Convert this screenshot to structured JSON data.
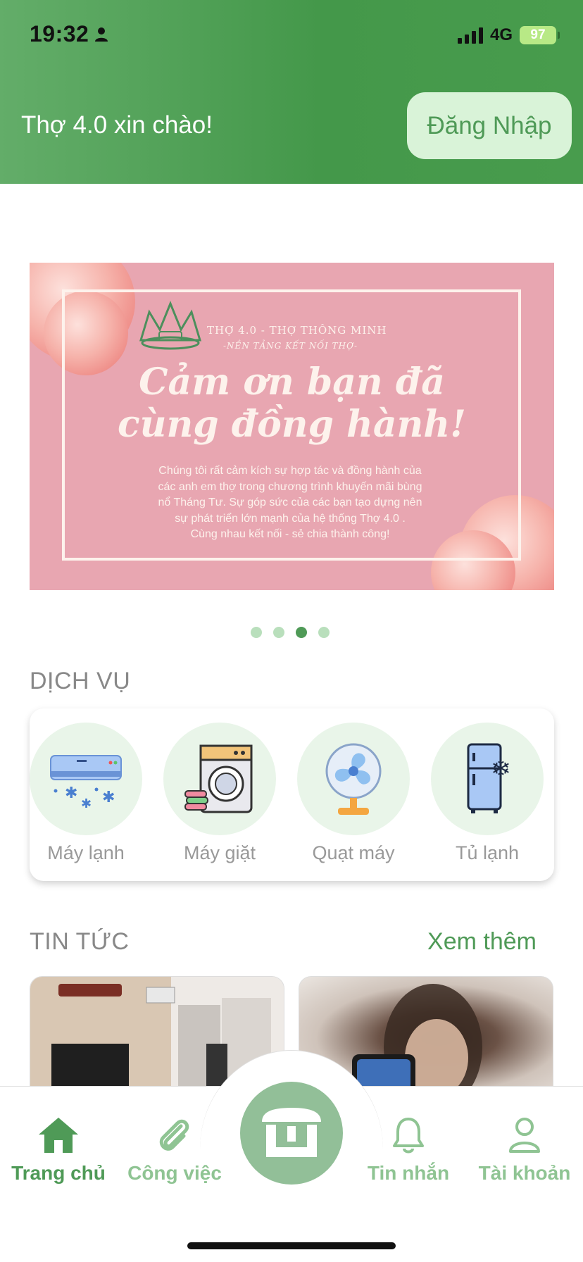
{
  "status": {
    "time": "19:32",
    "network": "4G",
    "battery": "97"
  },
  "header": {
    "greeting": "Thợ 4.0 xin chào!",
    "login_label": "Đăng Nhập"
  },
  "banner": {
    "brand": "THỢ 4.0 - THỢ THÔNG MINH",
    "brand_sub": "-NỀN TẢNG KẾT NỐI THỢ-",
    "title_line1": "Cảm ơn bạn đã",
    "title_line2": "cùng đồng hành!",
    "body": [
      "Chúng tôi rất cảm kích sự hợp tác và đồng hành của",
      "các anh em thợ trong chương trình khuyến mãi bùng",
      "nổ Tháng Tư. Sự góp sức của các bạn tạo dựng nên",
      "sự phát triển lớn mạnh của hệ thống Thợ 4.0 .",
      "Cùng nhau kết nối - sẻ chia thành công!"
    ],
    "active_slide": 3,
    "slide_count": 4
  },
  "services": {
    "title": "DỊCH VỤ",
    "items": [
      {
        "label": "Máy lạnh",
        "icon": "air-conditioner-icon"
      },
      {
        "label": "Máy giặt",
        "icon": "washing-machine-icon"
      },
      {
        "label": "Quạt máy",
        "icon": "fan-icon"
      },
      {
        "label": "Tủ lạnh",
        "icon": "fridge-icon"
      }
    ]
  },
  "news": {
    "title": "TIN TỨC",
    "see_more": "Xem thêm"
  },
  "nav": {
    "items": [
      {
        "label": "Trang chủ",
        "icon": "home-icon",
        "active": true
      },
      {
        "label": "Công việc",
        "icon": "paperclip-icon",
        "active": false
      },
      {
        "label": "Tin nhắn",
        "icon": "bell-icon",
        "active": false
      },
      {
        "label": "Tài khoản",
        "icon": "user-icon",
        "active": false
      }
    ],
    "center_icon": "store-icon"
  },
  "colors": {
    "primary": "#4f9a57",
    "light": "#d9f3d8",
    "banner": "#e8a6b1"
  }
}
